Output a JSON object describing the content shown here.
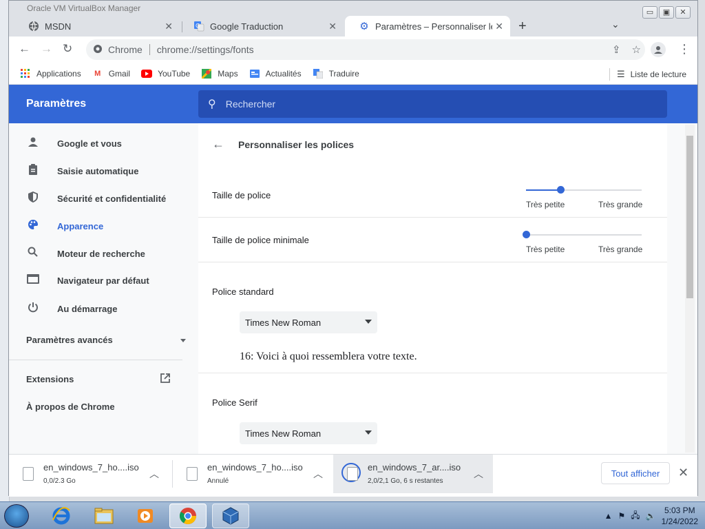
{
  "background": {
    "window_title": "Oracle VM VirtualBox Manager"
  },
  "window": {
    "controls": [
      "▭",
      "▣",
      "✕"
    ]
  },
  "tabs": [
    {
      "label": "MSDN",
      "icon": "globe-icon"
    },
    {
      "label": "Google Traduction",
      "icon": "google-translate-icon"
    },
    {
      "label": "Paramètres – Personnaliser les po",
      "icon": "settings-gear-icon",
      "active": true
    }
  ],
  "toolbar": {
    "scheme_label": "Chrome",
    "url": "chrome://settings/fonts"
  },
  "bookmarks": [
    {
      "label": "Applications",
      "icon": "apps-grid-icon"
    },
    {
      "label": "Gmail",
      "icon": "gmail-icon"
    },
    {
      "label": "YouTube",
      "icon": "youtube-icon"
    },
    {
      "label": "Maps",
      "icon": "maps-icon"
    },
    {
      "label": "Actualités",
      "icon": "news-icon"
    },
    {
      "label": "Traduire",
      "icon": "translate-icon"
    }
  ],
  "reading_list": "Liste de lecture",
  "settings": {
    "title": "Paramètres",
    "search_placeholder": "Rechercher",
    "sidebar": [
      {
        "label": "Google et vous",
        "icon": "person-icon"
      },
      {
        "label": "Saisie automatique",
        "icon": "clipboard-icon"
      },
      {
        "label": "Sécurité et confidentialité",
        "icon": "shield-icon"
      },
      {
        "label": "Apparence",
        "icon": "palette-icon",
        "active": true
      },
      {
        "label": "Moteur de recherche",
        "icon": "search-icon"
      },
      {
        "label": "Navigateur par défaut",
        "icon": "browser-icon"
      },
      {
        "label": "Au démarrage",
        "icon": "power-icon"
      }
    ],
    "advanced": "Paramètres avancés",
    "extensions": "Extensions",
    "about": "À propos de Chrome"
  },
  "fonts_page": {
    "title": "Personnaliser les polices",
    "font_size": {
      "label": "Taille de police",
      "min_label": "Très petite",
      "max_label": "Très grande",
      "value_fraction": 0.3
    },
    "min_font_size": {
      "label": "Taille de police minimale",
      "min_label": "Très petite",
      "max_label": "Très grande",
      "value_fraction": 0.0
    },
    "standard_font": {
      "label": "Police standard",
      "value": "Times New Roman",
      "preview": "16: Voici à quoi ressemblera votre texte."
    },
    "serif_font": {
      "label": "Police Serif",
      "value": "Times New Roman"
    }
  },
  "downloads": {
    "items": [
      {
        "name": "en_windows_7_ho....iso",
        "status": "0,0/2.3 Go"
      },
      {
        "name": "en_windows_7_ho....iso",
        "status": "Annulé"
      },
      {
        "name": "en_windows_7_​ar....iso",
        "status": "2,0/2,1 Go, 6 s restantes"
      }
    ],
    "show_all": "Tout afficher"
  },
  "taskbar": {
    "time": "5:03 PM",
    "date": "1/24/2022"
  }
}
